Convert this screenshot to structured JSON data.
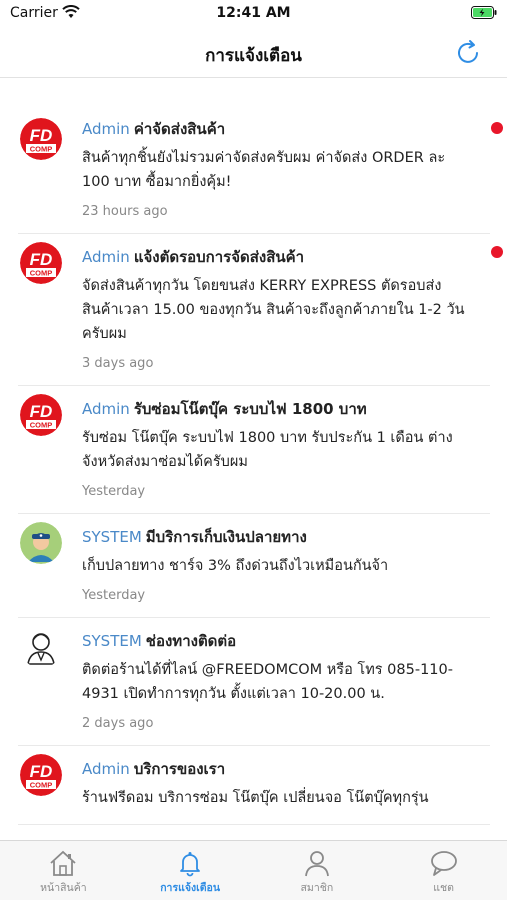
{
  "status_bar": {
    "carrier": "Carrier",
    "time": "12:41 AM"
  },
  "header": {
    "title": "การแจ้งเตือน"
  },
  "notifications": [
    {
      "avatar": "fd-comp-logo",
      "sender": "Admin",
      "subject": "ค่าจัดส่งสินค้า",
      "body": "สินค้าทุกชิ้นยังไม่รวมค่าจัดส่งครับผม ค่าจัดส่ง ORDER ละ 100 บาท ซื้อมากยิ่งคุ้ม!",
      "time": "23 hours ago",
      "unread": true
    },
    {
      "avatar": "fd-comp-logo",
      "sender": "Admin",
      "subject": "แจ้งตัดรอบการจัดส่งสินค้า",
      "body": "จัดส่งสินค้าทุกวัน โดยขนส่ง KERRY EXPRESS ตัดรอบส่งสินค้าเวลา 15.00 ของทุกวัน สินค้าจะถึงลูกค้าภายใน 1-2 วันครับผม",
      "time": "3 days ago",
      "unread": true
    },
    {
      "avatar": "fd-comp-logo",
      "sender": "Admin",
      "subject": "รับซ่อมโน๊ตบุ๊ค ระบบไฟ 1800 บาท",
      "body": "รับซ่อม โน๊ตบุ๊ค ระบบไฟ 1800 บาท รับประกัน 1 เดือน ต่างจังหวัดส่งมาซ่อมได้ครับผม",
      "time": "Yesterday",
      "unread": false
    },
    {
      "avatar": "delivery-person-avatar",
      "sender": "SYSTEM",
      "subject": "มีบริการเก็บเงินปลายทาง",
      "body": "เก็บปลายทาง ชาร์จ 3% ถึงด่วนถึงไวเหมือนกันจ้า",
      "time": "Yesterday",
      "unread": false
    },
    {
      "avatar": "support-person-avatar",
      "sender": "SYSTEM",
      "subject": "ช่องทางติดต่อ",
      "body": "ติดต่อร้านได้ที่ไลน์ @FREEDOMCOM หรือ โทร 085-110-4931 เปิดทำการทุกวัน ตั้งแต่เวลา 10-20.00 น.",
      "time": "2 days ago",
      "unread": false
    },
    {
      "avatar": "fd-comp-logo",
      "sender": "Admin",
      "subject": "บริการของเรา",
      "body": "ร้านฟรีดอม บริการซ่อม โน๊ตบุ๊ค เปลี่ยนจอ โน๊ตบุ๊คทุกรุ่น",
      "time": "",
      "unread": false
    }
  ],
  "tabs": [
    {
      "label": "หน้าสินค้า",
      "icon": "home-icon",
      "active": false
    },
    {
      "label": "การแจ้งเตือน",
      "icon": "bell-icon",
      "active": true
    },
    {
      "label": "สมาชิก",
      "icon": "person-icon",
      "active": false
    },
    {
      "label": "แชต",
      "icon": "chat-icon",
      "active": false
    }
  ],
  "colors": {
    "accent": "#2f8de4",
    "sender": "#4a89c8",
    "unread": "#e8162a",
    "logo_red": "#e0151d"
  }
}
